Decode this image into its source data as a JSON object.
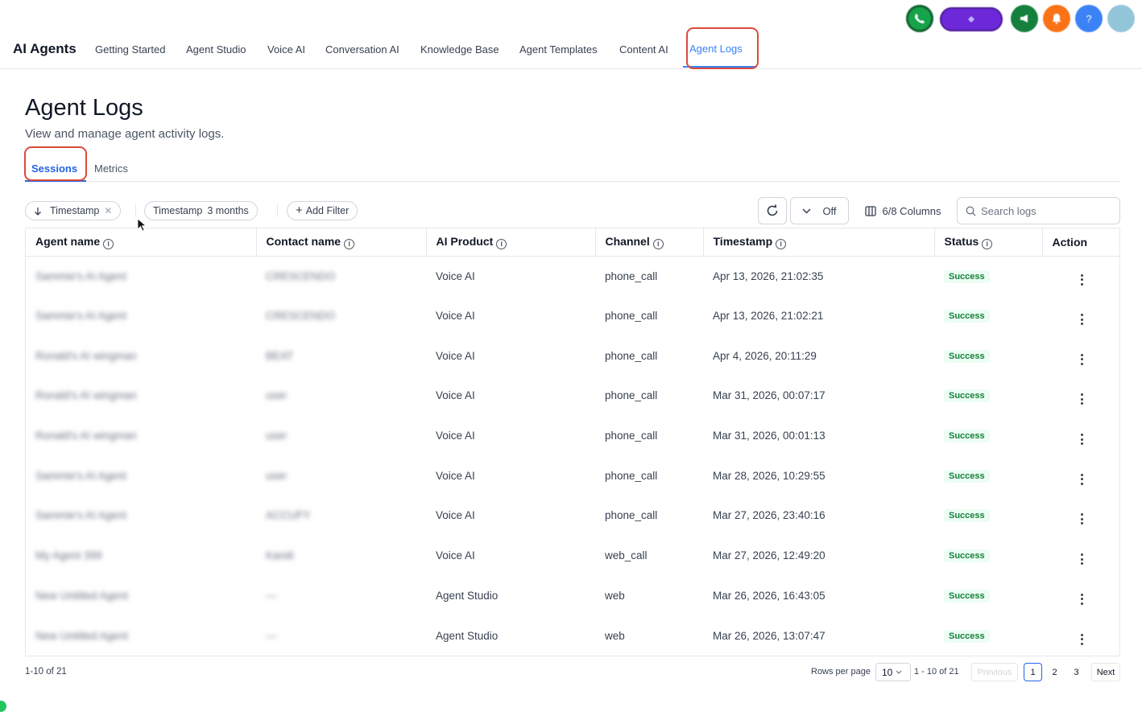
{
  "app": {
    "brand": "AI Agents"
  },
  "nav": {
    "items": [
      {
        "label": "Getting Started"
      },
      {
        "label": "Agent Studio"
      },
      {
        "label": "Voice AI"
      },
      {
        "label": "Conversation AI"
      },
      {
        "label": "Knowledge Base"
      },
      {
        "label": "Agent Templates"
      },
      {
        "label": "Content AI"
      },
      {
        "label": "Agent Logs",
        "active": true
      }
    ]
  },
  "header_icons": [
    {
      "name": "phone-icon",
      "color": "#16a34a"
    },
    {
      "name": "status-pill",
      "color": "#6d28d9"
    },
    {
      "name": "megaphone-icon",
      "color": "#15803d"
    },
    {
      "name": "bell-icon",
      "color": "#f97316"
    },
    {
      "name": "help-icon",
      "color": "#3b82f6"
    },
    {
      "name": "avatar",
      "color": "#93c5d8"
    }
  ],
  "page": {
    "title": "Agent Logs",
    "subtitle": "View and manage agent activity logs."
  },
  "subtabs": [
    {
      "label": "Sessions",
      "active": true
    },
    {
      "label": "Metrics"
    }
  ],
  "filters": {
    "sort_chip": "Timestamp",
    "range_chip_label": "Timestamp",
    "range_chip_value": "3 months",
    "add_filter": "Add Filter"
  },
  "toolbar": {
    "auto_refresh": "Off",
    "columns": "6/8 Columns",
    "search_placeholder": "Search logs"
  },
  "table": {
    "columns": [
      "Agent name",
      "Contact name",
      "AI Product",
      "Channel",
      "Timestamp",
      "Status",
      "Action"
    ],
    "rows": [
      {
        "agent": "Sammie's AI Agent",
        "contact": "CRESCENDO",
        "product": "Voice AI",
        "channel": "phone_call",
        "timestamp": "Apr 13, 2026, 21:02:35",
        "status": "Success"
      },
      {
        "agent": "Sammie's AI Agent",
        "contact": "CRESCENDO",
        "product": "Voice AI",
        "channel": "phone_call",
        "timestamp": "Apr 13, 2026, 21:02:21",
        "status": "Success"
      },
      {
        "agent": "Ronald's AI wingman",
        "contact": "BEAT",
        "product": "Voice AI",
        "channel": "phone_call",
        "timestamp": "Apr 4, 2026, 20:11:29",
        "status": "Success"
      },
      {
        "agent": "Ronald's AI wingman",
        "contact": "user",
        "product": "Voice AI",
        "channel": "phone_call",
        "timestamp": "Mar 31, 2026, 00:07:17",
        "status": "Success"
      },
      {
        "agent": "Ronald's AI wingman",
        "contact": "user",
        "product": "Voice AI",
        "channel": "phone_call",
        "timestamp": "Mar 31, 2026, 00:01:13",
        "status": "Success"
      },
      {
        "agent": "Sammie's AI Agent",
        "contact": "user",
        "product": "Voice AI",
        "channel": "phone_call",
        "timestamp": "Mar 28, 2026, 10:29:55",
        "status": "Success"
      },
      {
        "agent": "Sammie's AI Agent",
        "contact": "ACCUFY",
        "product": "Voice AI",
        "channel": "phone_call",
        "timestamp": "Mar 27, 2026, 23:40:16",
        "status": "Success"
      },
      {
        "agent": "My Agent 399",
        "contact": "Kandi",
        "product": "Voice AI",
        "channel": "web_call",
        "timestamp": "Mar 27, 2026, 12:49:20",
        "status": "Success"
      },
      {
        "agent": "New Untitled Agent",
        "contact": "—",
        "product": "Agent Studio",
        "channel": "web",
        "timestamp": "Mar 26, 2026, 16:43:05",
        "status": "Success"
      },
      {
        "agent": "New Untitled Agent",
        "contact": "—",
        "product": "Agent Studio",
        "channel": "web",
        "timestamp": "Mar 26, 2026, 13:07:47",
        "status": "Success"
      }
    ]
  },
  "footer": {
    "count": "1-10 of 21",
    "rows_per_page_label": "Rows per page",
    "rows_per_page": "10",
    "range": "1 - 10 of 21",
    "previous": "Previous",
    "pages": [
      "1",
      "2",
      "3"
    ],
    "next": "Next"
  }
}
